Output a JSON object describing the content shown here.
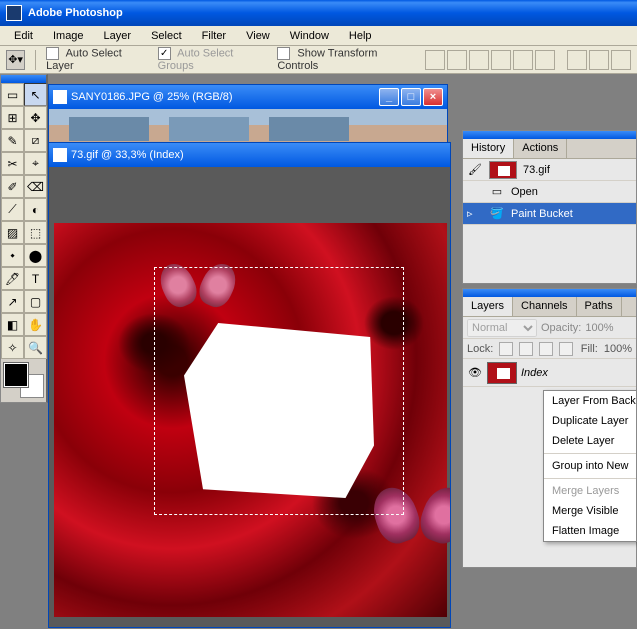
{
  "app": {
    "title": "Adobe Photoshop"
  },
  "menu": [
    "Edit",
    "Image",
    "Layer",
    "Select",
    "Filter",
    "View",
    "Window",
    "Help"
  ],
  "options": {
    "auto_select_layer": "Auto Select Layer",
    "auto_select_groups": "Auto Select Groups",
    "show_transform": "Show Transform Controls"
  },
  "documents": {
    "win1": {
      "title": "SANY0186.JPG @ 25% (RGB/8)"
    },
    "win2": {
      "title": "73.gif @ 33,3% (Index)"
    }
  },
  "history_panel": {
    "tabs": [
      "History",
      "Actions"
    ],
    "source": "73.gif",
    "items": [
      {
        "label": "Open"
      },
      {
        "label": "Paint Bucket",
        "active": true
      }
    ]
  },
  "layers_panel": {
    "tabs": [
      "Layers",
      "Channels",
      "Paths"
    ],
    "blend_mode": "Normal",
    "opacity_label": "Opacity:",
    "opacity_value": "100%",
    "lock_label": "Lock:",
    "fill_label": "Fill:",
    "fill_value": "100%",
    "layer": {
      "name": "Index"
    }
  },
  "context_menu": [
    {
      "label": "Layer From Background",
      "type": "item"
    },
    {
      "label": "Duplicate Layer",
      "type": "item"
    },
    {
      "label": "Delete Layer",
      "type": "item"
    },
    {
      "type": "sep"
    },
    {
      "label": "Group into New",
      "type": "item"
    },
    {
      "type": "sep"
    },
    {
      "label": "Merge Layers",
      "type": "item",
      "disabled": true
    },
    {
      "label": "Merge Visible",
      "type": "item"
    },
    {
      "label": "Flatten Image",
      "type": "item"
    }
  ],
  "tools": [
    "▭",
    "↖",
    "⊞",
    "✥",
    "✎",
    "⧄",
    "✂",
    "⌖",
    "✐",
    "⌫",
    "⟋",
    "◐",
    "▨",
    "⬚",
    "⬩",
    "⬤",
    "🖊",
    "T",
    "↗",
    "▢",
    "◧",
    "✋",
    "✧",
    "🔍"
  ]
}
